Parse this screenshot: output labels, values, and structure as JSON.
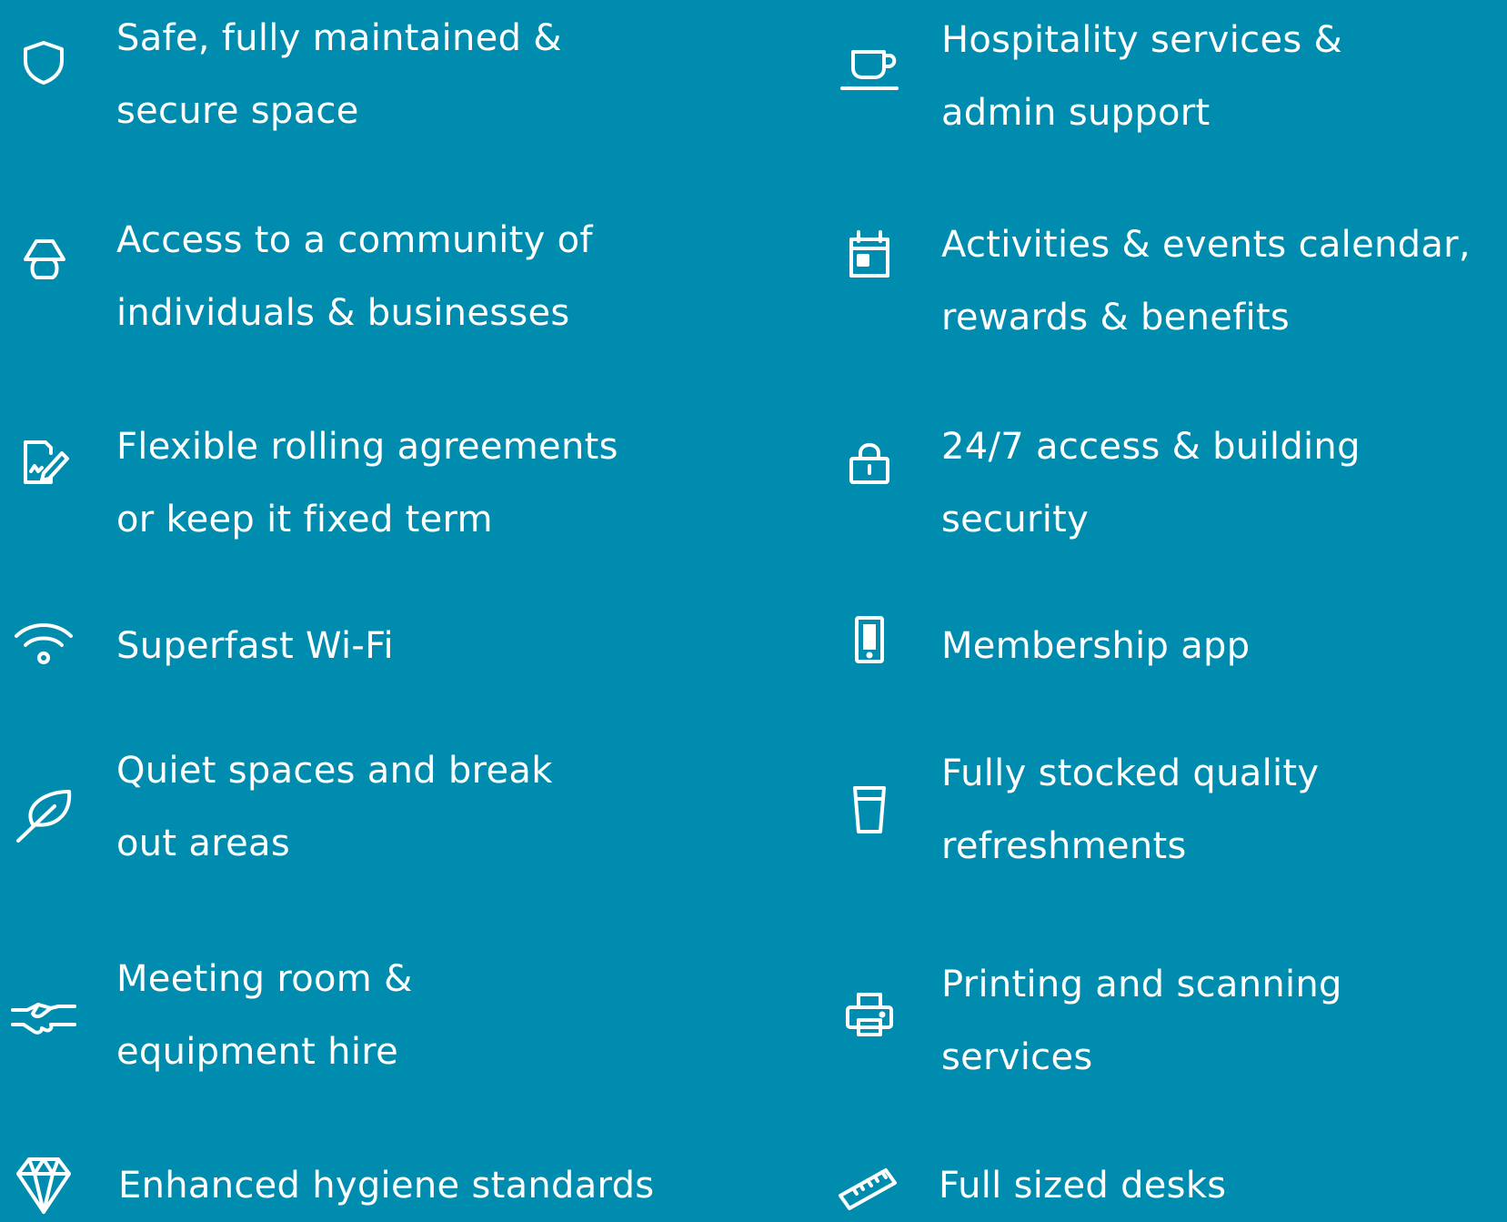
{
  "theme": {
    "background": "#008CAE",
    "text": "#ffffff"
  },
  "left_column": [
    {
      "icon": "shield-icon",
      "lines": [
        "Safe, fully maintained &",
        "secure space"
      ]
    },
    {
      "icon": "lamp-icon",
      "lines": [
        "Access to a community of",
        "individuals & businesses"
      ]
    },
    {
      "icon": "contract-signature-icon",
      "lines": [
        "Flexible rolling agreements",
        "or keep it fixed term"
      ]
    },
    {
      "icon": "wifi-icon",
      "lines": [
        "Superfast Wi-Fi"
      ]
    },
    {
      "icon": "leaf-icon",
      "lines": [
        "Quiet spaces and break",
        "out areas"
      ]
    },
    {
      "icon": "handshake-icon",
      "lines": [
        "Meeting room &",
        "equipment hire"
      ]
    },
    {
      "icon": "diamond-icon",
      "lines": [
        "Enhanced hygiene standards"
      ]
    }
  ],
  "right_column": [
    {
      "icon": "coffee-cup-icon",
      "lines": [
        "Hospitality services &",
        "admin support"
      ]
    },
    {
      "icon": "calendar-icon",
      "lines": [
        "Activities & events calendar,",
        "rewards & benefits"
      ]
    },
    {
      "icon": "lock-icon",
      "lines": [
        "24/7 access & building",
        "security"
      ]
    },
    {
      "icon": "mobile-phone-icon",
      "lines": [
        "Membership app"
      ]
    },
    {
      "icon": "glass-icon",
      "lines": [
        "Fully stocked quality",
        "refreshments"
      ]
    },
    {
      "icon": "printer-icon",
      "lines": [
        "Printing and scanning",
        "services"
      ]
    },
    {
      "icon": "ruler-icon",
      "lines": [
        "Full sized desks"
      ]
    }
  ]
}
